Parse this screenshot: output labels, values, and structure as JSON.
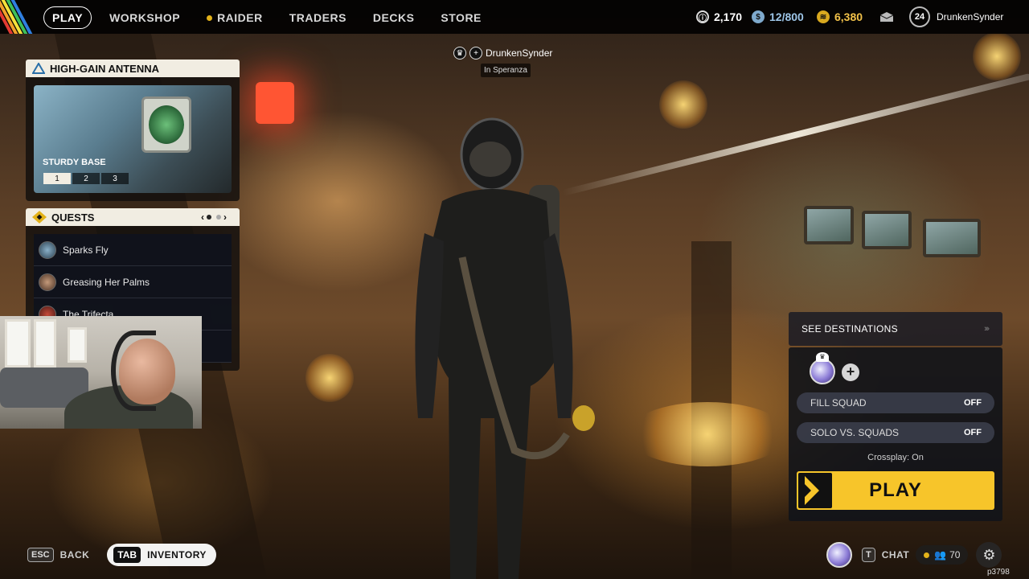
{
  "topbar": {
    "nav": {
      "play": "PLAY",
      "workshop": "WORKSHOP",
      "raider": "RAIDER",
      "traders": "TRADERS",
      "decks": "DECKS",
      "store": "STORE"
    },
    "currency": {
      "coins": "2,170",
      "credits": "12/800",
      "tokens": "6,380"
    },
    "level": "24",
    "username": "DrunkenSynder"
  },
  "player_tag": {
    "name": "DrunkenSynder",
    "location": "In Speranza"
  },
  "antenna": {
    "title": "HIGH-GAIN ANTENNA",
    "subtitle": "STURDY BASE",
    "tiers": [
      "1",
      "2",
      "3"
    ],
    "selected_tier": "1"
  },
  "quests": {
    "title": "QUESTS",
    "items": [
      {
        "label": "Sparks Fly"
      },
      {
        "label": "Greasing Her Palms"
      },
      {
        "label": "The Trifecta"
      }
    ]
  },
  "play_panel": {
    "destinations": "SEE DESTINATIONS",
    "fill_squad_label": "FILL SQUAD",
    "fill_squad_value": "OFF",
    "solo_label": "SOLO VS. SQUADS",
    "solo_value": "OFF",
    "crossplay": "Crossplay: On",
    "play_button": "PLAY"
  },
  "bottom": {
    "esc_key": "ESC",
    "back_label": "BACK",
    "tab_key": "TAB",
    "inventory_label": "INVENTORY",
    "chat_key": "T",
    "chat_label": "CHAT",
    "friends_count": "70",
    "build": "p3798"
  },
  "colors": {
    "accent_yellow": "#f7c52a",
    "card_header": "#f1ede2",
    "topbar": "#000000"
  },
  "icons": [
    "coin-icon",
    "credit-icon",
    "token-icon",
    "mail-icon",
    "warning-triangle-icon",
    "quest-diamond-icon",
    "crown-icon",
    "plus-icon",
    "gear-icon",
    "friends-icon",
    "chevron-right-icon"
  ]
}
